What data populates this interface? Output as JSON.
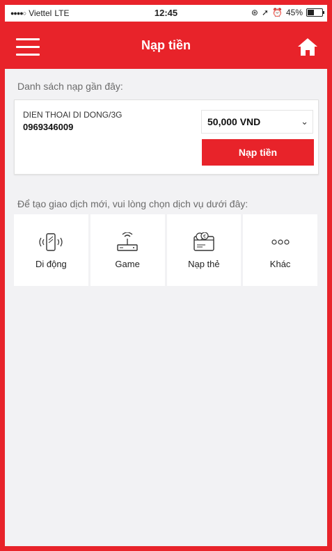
{
  "status_bar": {
    "carrier": "Viettel",
    "network": "LTE",
    "time": "12:45",
    "battery": "45%",
    "battery_level": 0.45
  },
  "header": {
    "title": "Nạp tiền",
    "menu_icon": "hamburger-icon",
    "home_icon": "home-icon"
  },
  "recent": {
    "label": "Danh sách nạp gần đây:",
    "items": [
      {
        "service": "DIEN THOAI DI DONG/3G",
        "phone": "0969346009",
        "amount": "50,000 VND",
        "button": "Nạp tiền"
      }
    ]
  },
  "services": {
    "label": "Để tạo giao dịch mới, vui lòng chọn dịch vụ dưới đây:",
    "items": [
      {
        "label": "Di động",
        "icon": "mobile-phone-icon"
      },
      {
        "label": "Game",
        "icon": "router-icon"
      },
      {
        "label": "Nạp thẻ",
        "icon": "card-topup-icon"
      },
      {
        "label": "Khác",
        "icon": "more-icon"
      }
    ]
  },
  "colors": {
    "accent": "#e8232a",
    "background": "#f2f2f4"
  }
}
